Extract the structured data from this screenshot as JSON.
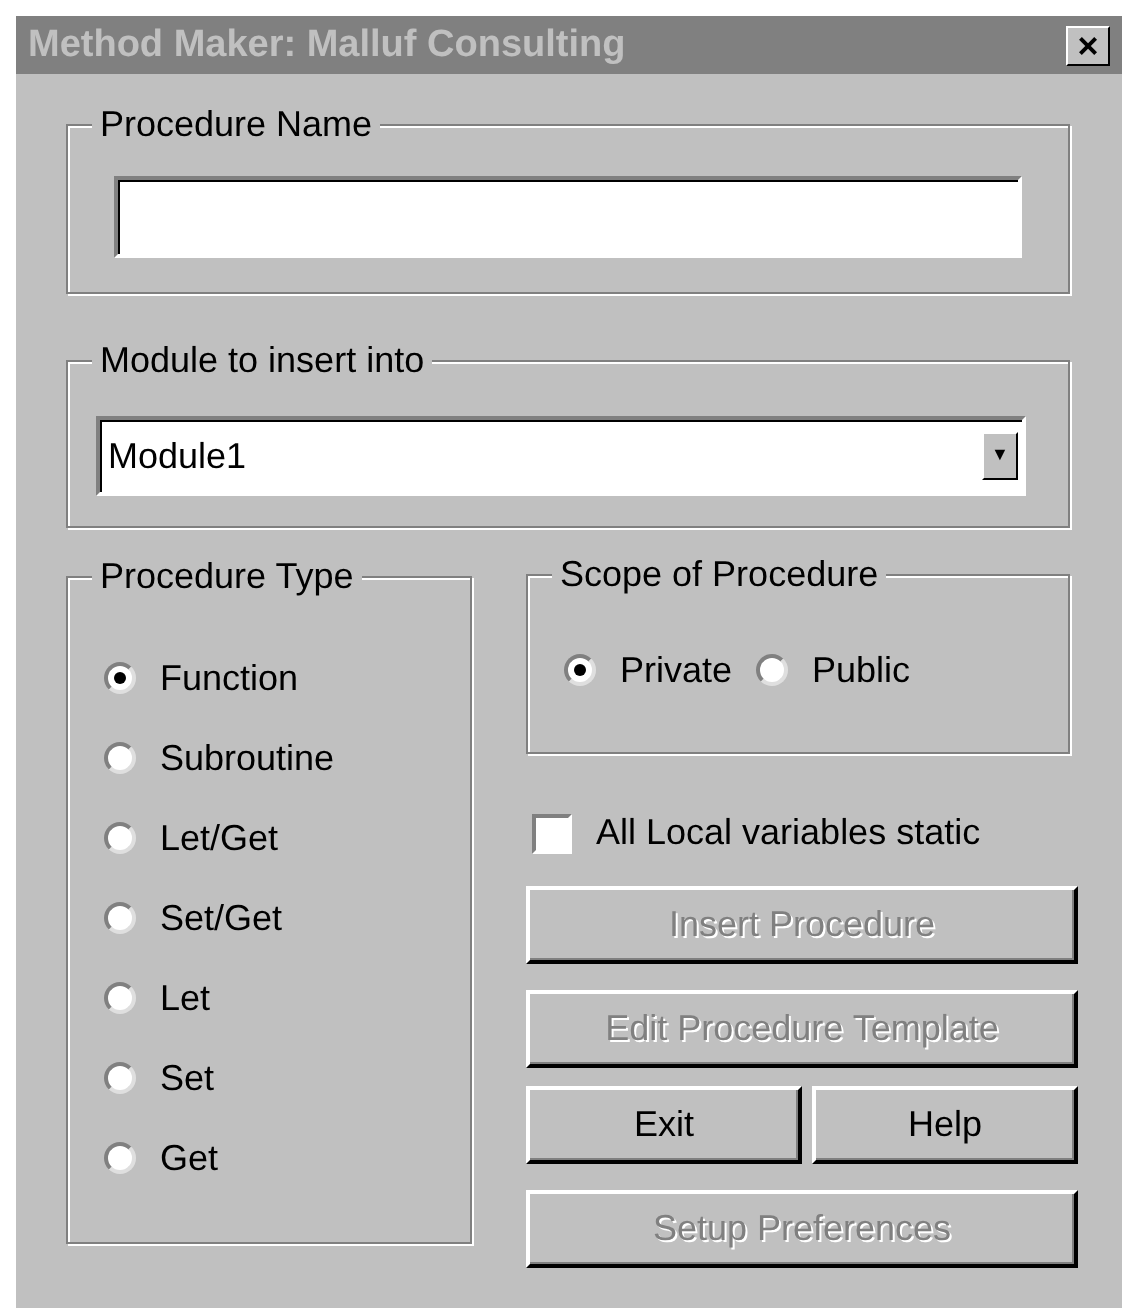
{
  "window": {
    "title": "Method Maker: Malluf Consulting",
    "close": "×"
  },
  "procedure_name": {
    "label": "Procedure Name"
  },
  "module": {
    "label": "Module to insert into",
    "value": "Module1",
    "dropdown": "▼"
  },
  "procedure_type": {
    "label": "Procedure Type",
    "options": [
      {
        "label": "Function",
        "selected": true
      },
      {
        "label": "Subroutine",
        "selected": false
      },
      {
        "label": "Let/Get",
        "selected": false
      },
      {
        "label": "Set/Get",
        "selected": false
      },
      {
        "label": "Let",
        "selected": false
      },
      {
        "label": "Set",
        "selected": false
      },
      {
        "label": "Get",
        "selected": false
      }
    ]
  },
  "scope": {
    "label": "Scope of Procedure",
    "options": [
      {
        "label": "Private",
        "selected": true
      },
      {
        "label": "Public",
        "selected": false
      }
    ]
  },
  "static_checkbox": {
    "label": "All Local variables static",
    "checked": false
  },
  "buttons": [
    {
      "label": "Insert Procedure",
      "disabled": true
    },
    {
      "label": "Edit Procedure Template",
      "disabled": true
    },
    {
      "label": "Exit",
      "disabled": false
    },
    {
      "label": "Help",
      "disabled": false
    },
    {
      "label": "Setup Preferences",
      "disabled": true
    }
  ]
}
